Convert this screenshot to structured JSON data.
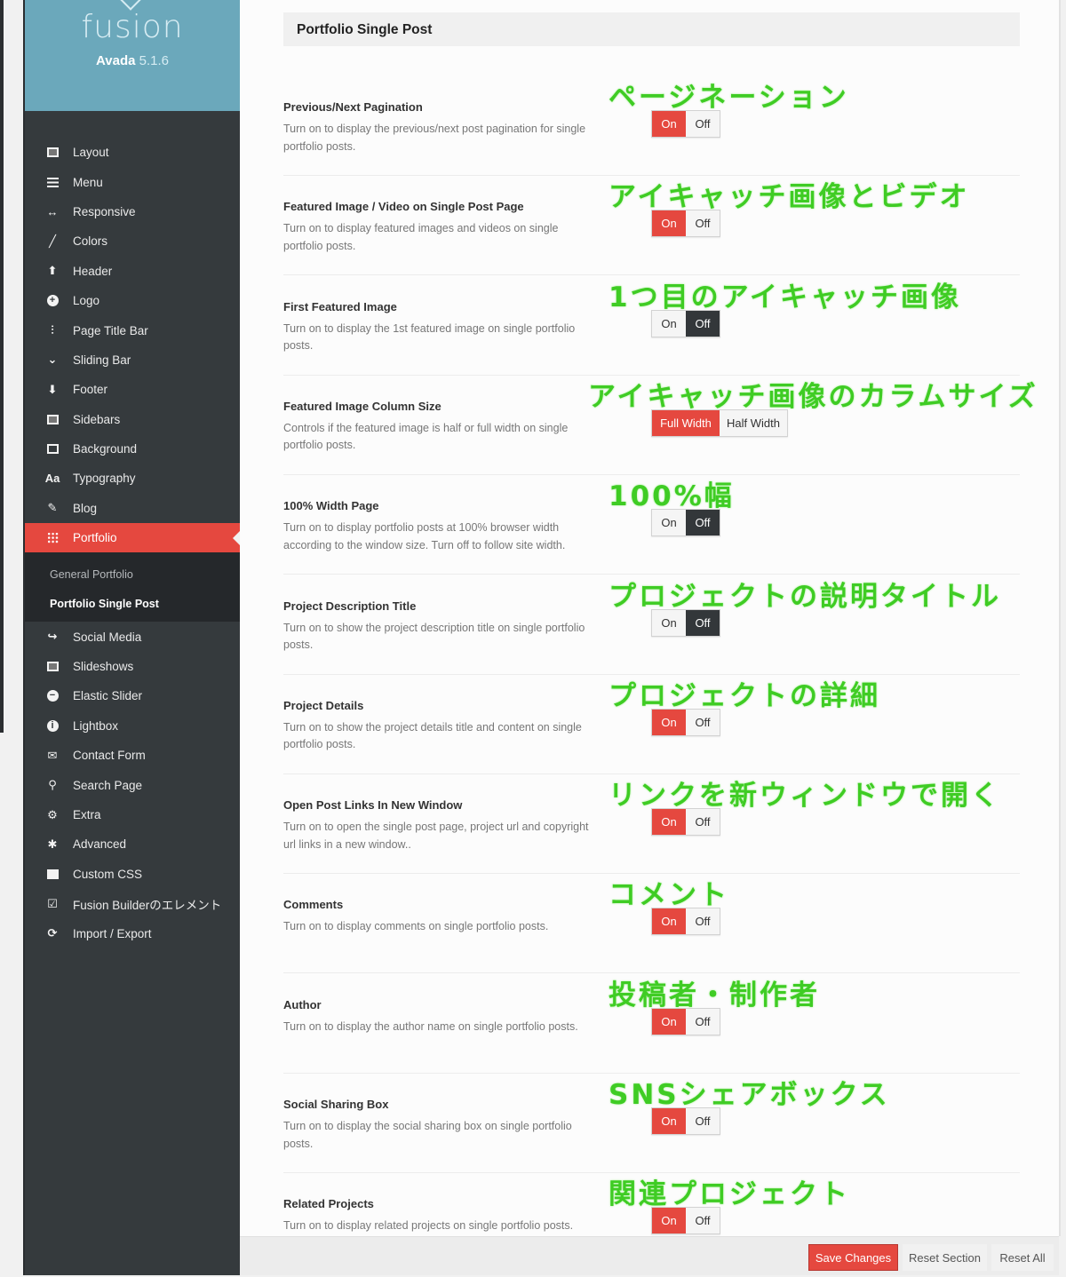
{
  "brand": {
    "logo_text": "fusion",
    "product_name": "Avada",
    "version": "5.1.6",
    "accent_color": "#6ba8bb"
  },
  "sidebar": {
    "items_before": [
      {
        "label": "Layout",
        "icon": "layout-icon"
      },
      {
        "label": "Menu",
        "icon": "menu-icon"
      },
      {
        "label": "Responsive",
        "icon": "arrows-h-icon"
      },
      {
        "label": "Colors",
        "icon": "brush-icon"
      },
      {
        "label": "Header",
        "icon": "arrow-up-icon"
      },
      {
        "label": "Logo",
        "icon": "plus-circle-icon"
      },
      {
        "label": "Page Title Bar",
        "icon": "sliders-icon"
      },
      {
        "label": "Sliding Bar",
        "icon": "chevron-down-icon"
      },
      {
        "label": "Footer",
        "icon": "arrow-down-icon"
      },
      {
        "label": "Sidebars",
        "icon": "sidebars-icon"
      },
      {
        "label": "Background",
        "icon": "background-icon"
      },
      {
        "label": "Typography",
        "icon": "typography-icon"
      },
      {
        "label": "Blog",
        "icon": "edit-icon"
      }
    ],
    "active_item": {
      "label": "Portfolio",
      "icon": "grid-icon"
    },
    "sub_items": [
      {
        "label": "General Portfolio",
        "current": false
      },
      {
        "label": "Portfolio Single Post",
        "current": true
      }
    ],
    "items_after": [
      {
        "label": "Social Media",
        "icon": "share-icon"
      },
      {
        "label": "Slideshows",
        "icon": "image-icon"
      },
      {
        "label": "Elastic Slider",
        "icon": "minus-circle-icon"
      },
      {
        "label": "Lightbox",
        "icon": "info-circle-icon"
      },
      {
        "label": "Contact Form",
        "icon": "envelope-icon"
      },
      {
        "label": "Search Page",
        "icon": "search-icon"
      },
      {
        "label": "Extra",
        "icon": "cogs-icon"
      },
      {
        "label": "Advanced",
        "icon": "puzzle-icon"
      },
      {
        "label": "Custom CSS",
        "icon": "code-icon"
      },
      {
        "label": "Fusion Builderのエレメント",
        "icon": "checkbox-icon"
      },
      {
        "label": "Import / Export",
        "icon": "refresh-icon"
      }
    ]
  },
  "section": {
    "title": "Portfolio Single Post"
  },
  "options": [
    {
      "title": "Previous/Next Pagination",
      "desc": "Turn on to display the previous/next post pagination for single portfolio posts.",
      "annotation": "ページネーション",
      "choices": [
        "On",
        "Off"
      ],
      "selected": "On"
    },
    {
      "title": "Featured Image / Video on Single Post Page",
      "desc": "Turn on to display featured images and videos on single portfolio posts.",
      "annotation": "アイキャッチ画像とビデオ",
      "choices": [
        "On",
        "Off"
      ],
      "selected": "On"
    },
    {
      "title": "First Featured Image",
      "desc": "Turn on to display the 1st featured image on single portfolio posts.",
      "annotation": "1つ目のアイキャッチ画像",
      "choices": [
        "On",
        "Off"
      ],
      "selected": "Off"
    },
    {
      "title": "Featured Image Column Size",
      "desc": "Controls if the featured image is half or full width on single portfolio posts.",
      "annotation": "アイキャッチ画像のカラムサイズ",
      "choices": [
        "Full Width",
        "Half Width"
      ],
      "selected": "Full Width"
    },
    {
      "title": "100% Width Page",
      "desc": "Turn on to display portfolio posts at 100% browser width according to the window size. Turn off to follow site width.",
      "annotation": "100%幅",
      "choices": [
        "On",
        "Off"
      ],
      "selected": "Off"
    },
    {
      "title": "Project Description Title",
      "desc": "Turn on to show the project description title on single portfolio posts.",
      "annotation": "プロジェクトの説明タイトル",
      "choices": [
        "On",
        "Off"
      ],
      "selected": "Off"
    },
    {
      "title": "Project Details",
      "desc": "Turn on to show the project details title and content on single portfolio posts.",
      "annotation": "プロジェクトの詳細",
      "choices": [
        "On",
        "Off"
      ],
      "selected": "On"
    },
    {
      "title": "Open Post Links In New Window",
      "desc": "Turn on to open the single post page, project url and copyright url links in a new window..",
      "annotation": "リンクを新ウィンドウで開く",
      "choices": [
        "On",
        "Off"
      ],
      "selected": "On"
    },
    {
      "title": "Comments",
      "desc": "Turn on to display comments on single portfolio posts.",
      "annotation": "コメント",
      "choices": [
        "On",
        "Off"
      ],
      "selected": "On"
    },
    {
      "title": "Author",
      "desc": "Turn on to display the author name on single portfolio posts.",
      "annotation": "投稿者・制作者",
      "choices": [
        "On",
        "Off"
      ],
      "selected": "On"
    },
    {
      "title": "Social Sharing Box",
      "desc": "Turn on to display the social sharing box on single portfolio posts.",
      "annotation": "SNSシェアボックス",
      "choices": [
        "On",
        "Off"
      ],
      "selected": "On"
    },
    {
      "title": "Related Projects",
      "desc": "Turn on to display related projects on single portfolio posts.",
      "annotation": "関連プロジェクト",
      "choices": [
        "On",
        "Off"
      ],
      "selected": "On"
    }
  ],
  "footer": {
    "save_label": "Save Changes",
    "reset_section_label": "Reset Section",
    "reset_all_label": "Reset All"
  },
  "colors": {
    "accent_red": "#e5483f",
    "selected_dark": "#33373a",
    "annotation_green": "#3fcc24",
    "sidebar_bg": "#353a3d"
  }
}
